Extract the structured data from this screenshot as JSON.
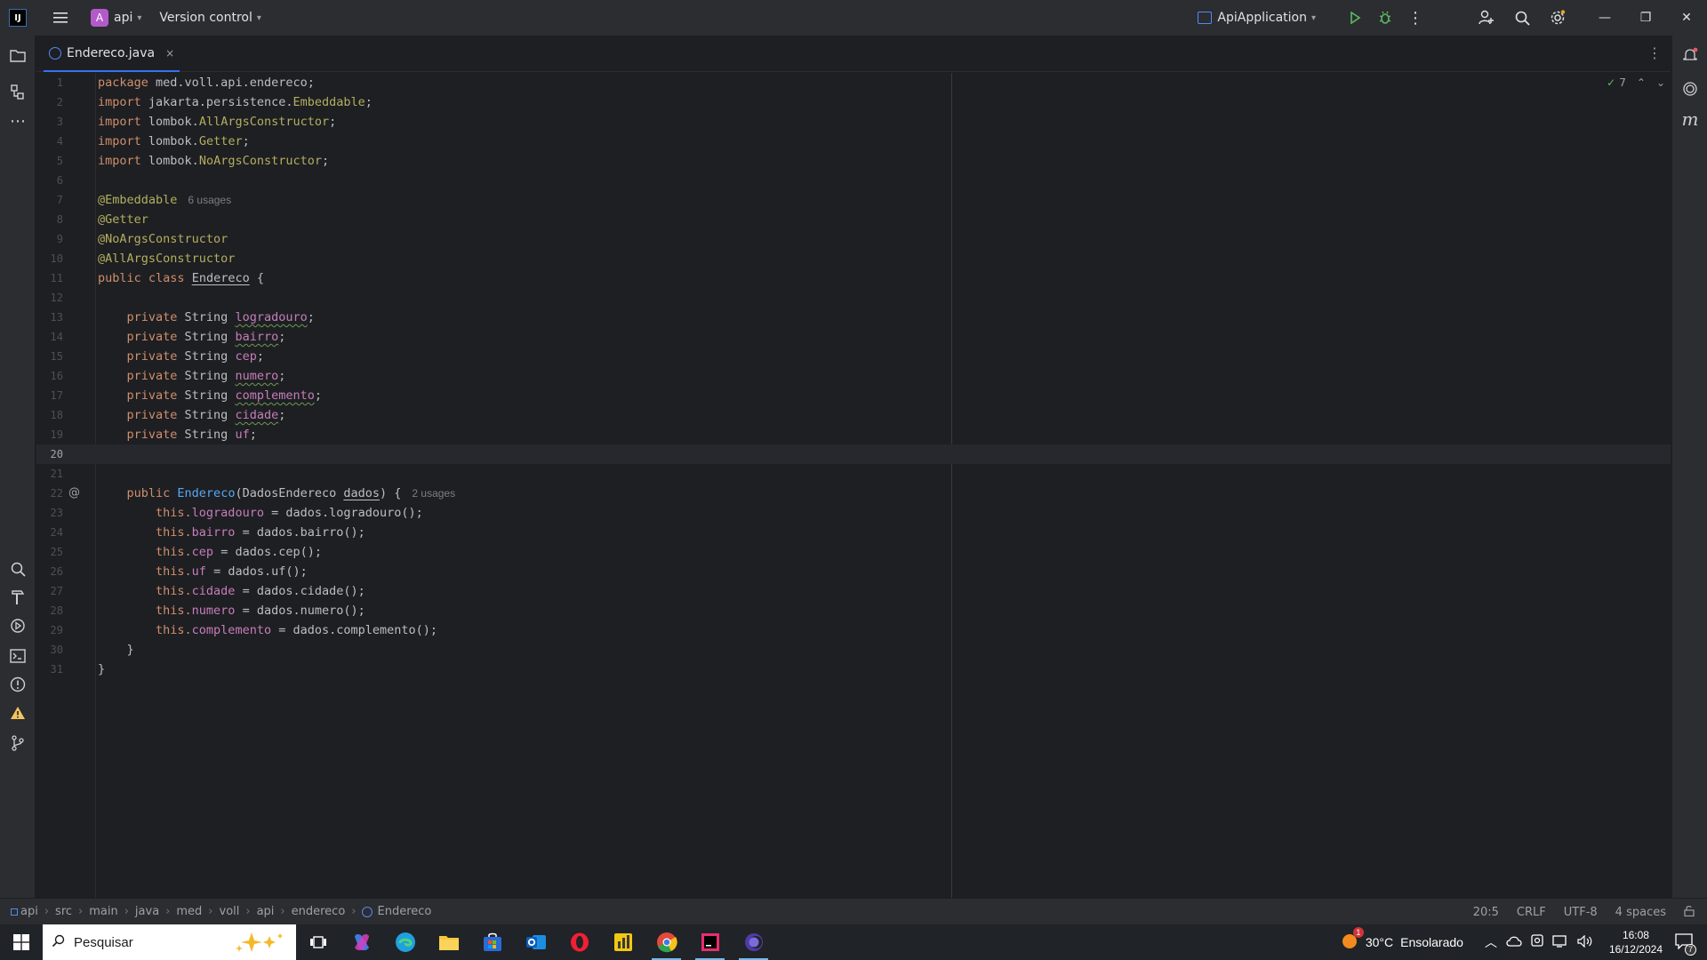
{
  "titlebar": {
    "project_badge": "A",
    "project_name": "api",
    "vcs_label": "Version control",
    "run_config": "ApiApplication"
  },
  "tab": {
    "file_name": "Endereco.java",
    "close": "×"
  },
  "editor": {
    "inspection_count": "7",
    "lines": [
      {
        "n": "1"
      },
      {
        "n": "2"
      },
      {
        "n": "3"
      },
      {
        "n": "4"
      },
      {
        "n": "5"
      },
      {
        "n": "6"
      },
      {
        "n": "7"
      },
      {
        "n": "8"
      },
      {
        "n": "9"
      },
      {
        "n": "10"
      },
      {
        "n": "11"
      },
      {
        "n": "12"
      },
      {
        "n": "13"
      },
      {
        "n": "14"
      },
      {
        "n": "15"
      },
      {
        "n": "16"
      },
      {
        "n": "17"
      },
      {
        "n": "18"
      },
      {
        "n": "19"
      },
      {
        "n": "20"
      },
      {
        "n": "21"
      },
      {
        "n": "22"
      },
      {
        "n": "23"
      },
      {
        "n": "24"
      },
      {
        "n": "25"
      },
      {
        "n": "26"
      },
      {
        "n": "27"
      },
      {
        "n": "28"
      },
      {
        "n": "29"
      },
      {
        "n": "30"
      },
      {
        "n": "31"
      }
    ],
    "code": {
      "l1_kw": "package",
      "l1_rest": " med.voll.api.endereco;",
      "l2_kw": "import",
      "l2_a": " jakarta.persistence.",
      "l2_ann": "Embeddable",
      "l2_end": ";",
      "l3_kw": "import",
      "l3_a": " lombok.",
      "l3_ann": "AllArgsConstructor",
      "l3_end": ";",
      "l4_kw": "import",
      "l4_a": " lombok.",
      "l4_ann": "Getter",
      "l4_end": ";",
      "l5_kw": "import",
      "l5_a": " lombok.",
      "l5_ann": "NoArgsConstructor",
      "l5_end": ";",
      "l7": "@Embeddable",
      "l7_usages": "6 usages",
      "l8": "@Getter",
      "l9": "@NoArgsConstructor",
      "l10": "@AllArgsConstructor",
      "l11_kw": "public class",
      "l11_name": "Endereco",
      "l11_end": " {",
      "priv": "    private",
      "str": " String ",
      "f13": "logradouro",
      "f14": "bairro",
      "f15": "cep",
      "f16": "numero",
      "f17": "complemento",
      "f18": "cidade",
      "f19": "uf",
      "semi": ";",
      "l22_kw": "    public",
      "l22_name": "Endereco",
      "l22_a": "(DadosEndereco ",
      "l22_param": "dados",
      "l22_end": ") {",
      "l22_usages": "2 usages",
      "this": "        this.",
      "a23_f": "logradouro",
      "a23_r": " = dados.logradouro();",
      "a24_f": "bairro",
      "a24_r": " = dados.bairro();",
      "a25_f": "cep",
      "a25_r": " = dados.cep();",
      "a26_f": "uf",
      "a26_r": " = dados.uf();",
      "a27_f": "cidade",
      "a27_r": " = dados.cidade();",
      "a28_f": "numero",
      "a28_r": " = dados.numero();",
      "a29_f": "complemento",
      "a29_r": " = dados.complemento();",
      "l30": "    }",
      "l31": "}"
    }
  },
  "statusbar": {
    "breadcrumbs": [
      "api",
      "src",
      "main",
      "java",
      "med",
      "voll",
      "api",
      "endereco",
      "Endereco"
    ],
    "position": "20:5",
    "line_sep": "CRLF",
    "encoding": "UTF-8",
    "indent": "4 spaces"
  },
  "taskbar": {
    "search_placeholder": "Pesquisar",
    "weather_temp": "30°C",
    "weather_desc": "Ensolarado",
    "weather_badge": "1",
    "time": "16:08",
    "date": "16/12/2024",
    "notif_count": "7"
  },
  "colors": {
    "accent": "#3574f0",
    "keyword": "#cf8e6d",
    "annotation": "#b3ae60",
    "field": "#c77dbb",
    "background": "#1e1f22"
  }
}
